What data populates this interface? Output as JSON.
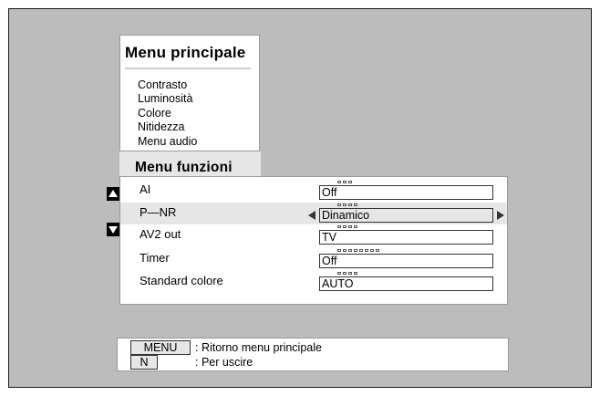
{
  "main_menu": {
    "title": "Menu principale",
    "items": [
      {
        "label": "Contrasto"
      },
      {
        "label": "Luminosità"
      },
      {
        "label": "Colore"
      },
      {
        "label": "Nitidezza"
      },
      {
        "label": "Menu audio"
      }
    ]
  },
  "functions_menu": {
    "title": "Menu funzioni",
    "rows": [
      {
        "label": "AI",
        "value": "Off",
        "level": 3
      },
      {
        "label": "P—NR",
        "value": "Dinamico",
        "level": 4
      },
      {
        "label": "AV2 out",
        "value": "TV",
        "level": 4
      },
      {
        "label": "Timer",
        "value": "Off",
        "level": 8
      },
      {
        "label": "Standard colore",
        "value": "AUTO",
        "level": 4
      }
    ],
    "selected_index": 1
  },
  "help": {
    "menu_key": "MENU",
    "menu_desc": ": Ritorno menu principale",
    "exit_key": "N",
    "exit_desc": ": Per uscire"
  }
}
